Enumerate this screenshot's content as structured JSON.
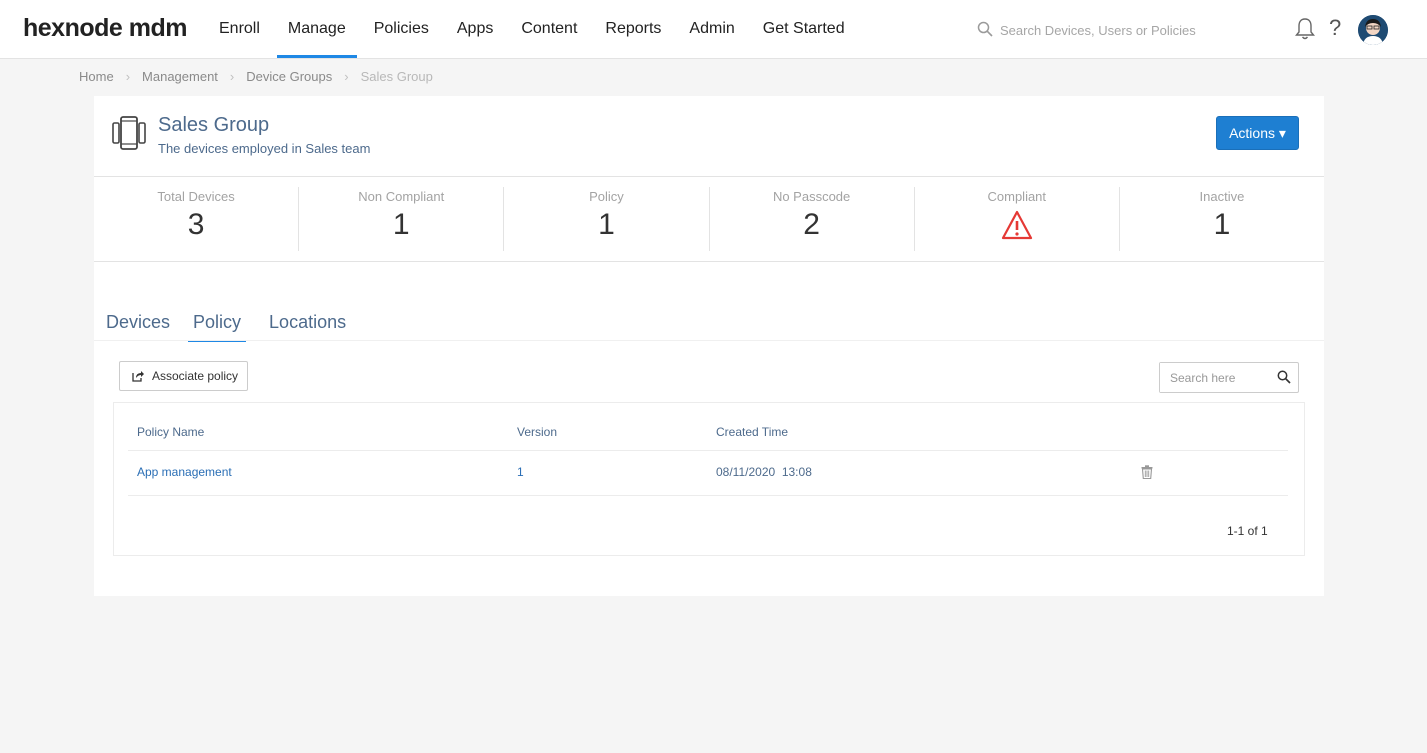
{
  "app": {
    "logo": "hexnode mdm"
  },
  "nav": {
    "items": [
      {
        "label": "Enroll"
      },
      {
        "label": "Manage",
        "active": true
      },
      {
        "label": "Policies"
      },
      {
        "label": "Apps"
      },
      {
        "label": "Content"
      },
      {
        "label": "Reports"
      },
      {
        "label": "Admin"
      },
      {
        "label": "Get Started"
      }
    ]
  },
  "header": {
    "search_placeholder": "Search Devices, Users or Policies",
    "icons": [
      "search-icon",
      "bell-icon",
      "help-icon",
      "avatar"
    ]
  },
  "breadcrumb": {
    "items": [
      "Home",
      "Management",
      "Device Groups",
      "Sales Group"
    ]
  },
  "group": {
    "title": "Sales Group",
    "description": "The devices employed in Sales team",
    "actions_label": "Actions ▾"
  },
  "stats": [
    {
      "label": "Total Devices",
      "value": "3"
    },
    {
      "label": "Non Compliant",
      "value": "1"
    },
    {
      "label": "Policy",
      "value": "1"
    },
    {
      "label": "No Passcode",
      "value": "2"
    },
    {
      "label": "Compliant",
      "value": "",
      "icon": "warning-icon"
    },
    {
      "label": "Inactive",
      "value": "1"
    }
  ],
  "tabs": [
    {
      "label": "Devices"
    },
    {
      "label": "Policy",
      "active": true
    },
    {
      "label": "Locations"
    }
  ],
  "toolbar": {
    "associate_label": "Associate policy",
    "search_placeholder": "Search here"
  },
  "table": {
    "columns": [
      "Policy Name",
      "Version",
      "Created Time"
    ],
    "rows": [
      {
        "name": "App management",
        "version": "1",
        "created": "08/11/2020  13:08"
      }
    ],
    "pager": "1-1 of 1"
  },
  "colors": {
    "accent": "#1e88e5",
    "primary_button": "#1e7fd2",
    "warning": "#e53935",
    "text_blue": "#4d6a8c"
  }
}
